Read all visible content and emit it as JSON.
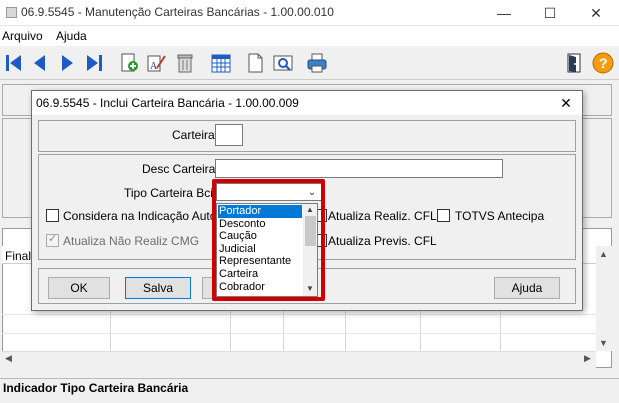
{
  "window": {
    "title": "06.9.5545 - Manutenção Carteiras Bancárias - 1.00.00.010",
    "minimize_icon": "minimize-icon",
    "maximize_icon": "maximize-icon",
    "close_icon": "close-icon"
  },
  "menu": {
    "items": [
      "Arquivo",
      "Ajuda"
    ]
  },
  "toolbar": {
    "icons": [
      "first-record-icon",
      "previous-record-icon",
      "next-record-icon",
      "last-record-icon",
      "add-record-icon",
      "edit-record-icon",
      "delete-record-icon",
      "calendar-grid-icon",
      "document-icon",
      "preview-icon",
      "print-icon",
      "exit-door-icon",
      "help-icon"
    ]
  },
  "grid": {
    "header_left": "Finali",
    "header_right": "Va"
  },
  "status": {
    "text": "Indicador Tipo Carteira Bancária"
  },
  "dialog": {
    "title": "06.9.5545 - Inclui Carteira Bancária - 1.00.00.009",
    "carteira_label": "Carteira:",
    "carteira_value": "",
    "desc_label": "Desc Carteira:",
    "desc_value": "",
    "tipo_label": "Tipo Carteira Bcia",
    "tipo_value": "",
    "checkboxes": {
      "considera": "Considera na Indicação Autom",
      "atualiza_nao_realiz": "Atualiza Não Realiz CMG",
      "atualiza_realiz_cfl": "Atualiza Realiz. CFL",
      "totvs_antecipa": "TOTVS Antecipa",
      "atualiza_previs_cfl": "Atualiza Previs. CFL"
    },
    "buttons": {
      "ok": "OK",
      "salva": "Salva",
      "ajuda": "Ajuda"
    },
    "tipo_options": [
      "Portador",
      "Desconto",
      "Caução",
      "Judicial",
      "Representante",
      "Carteira",
      "Cobrador"
    ],
    "tipo_selected_option": "Portador"
  },
  "colors": {
    "highlight_border": "#d00000",
    "selection": "#0078d7"
  }
}
